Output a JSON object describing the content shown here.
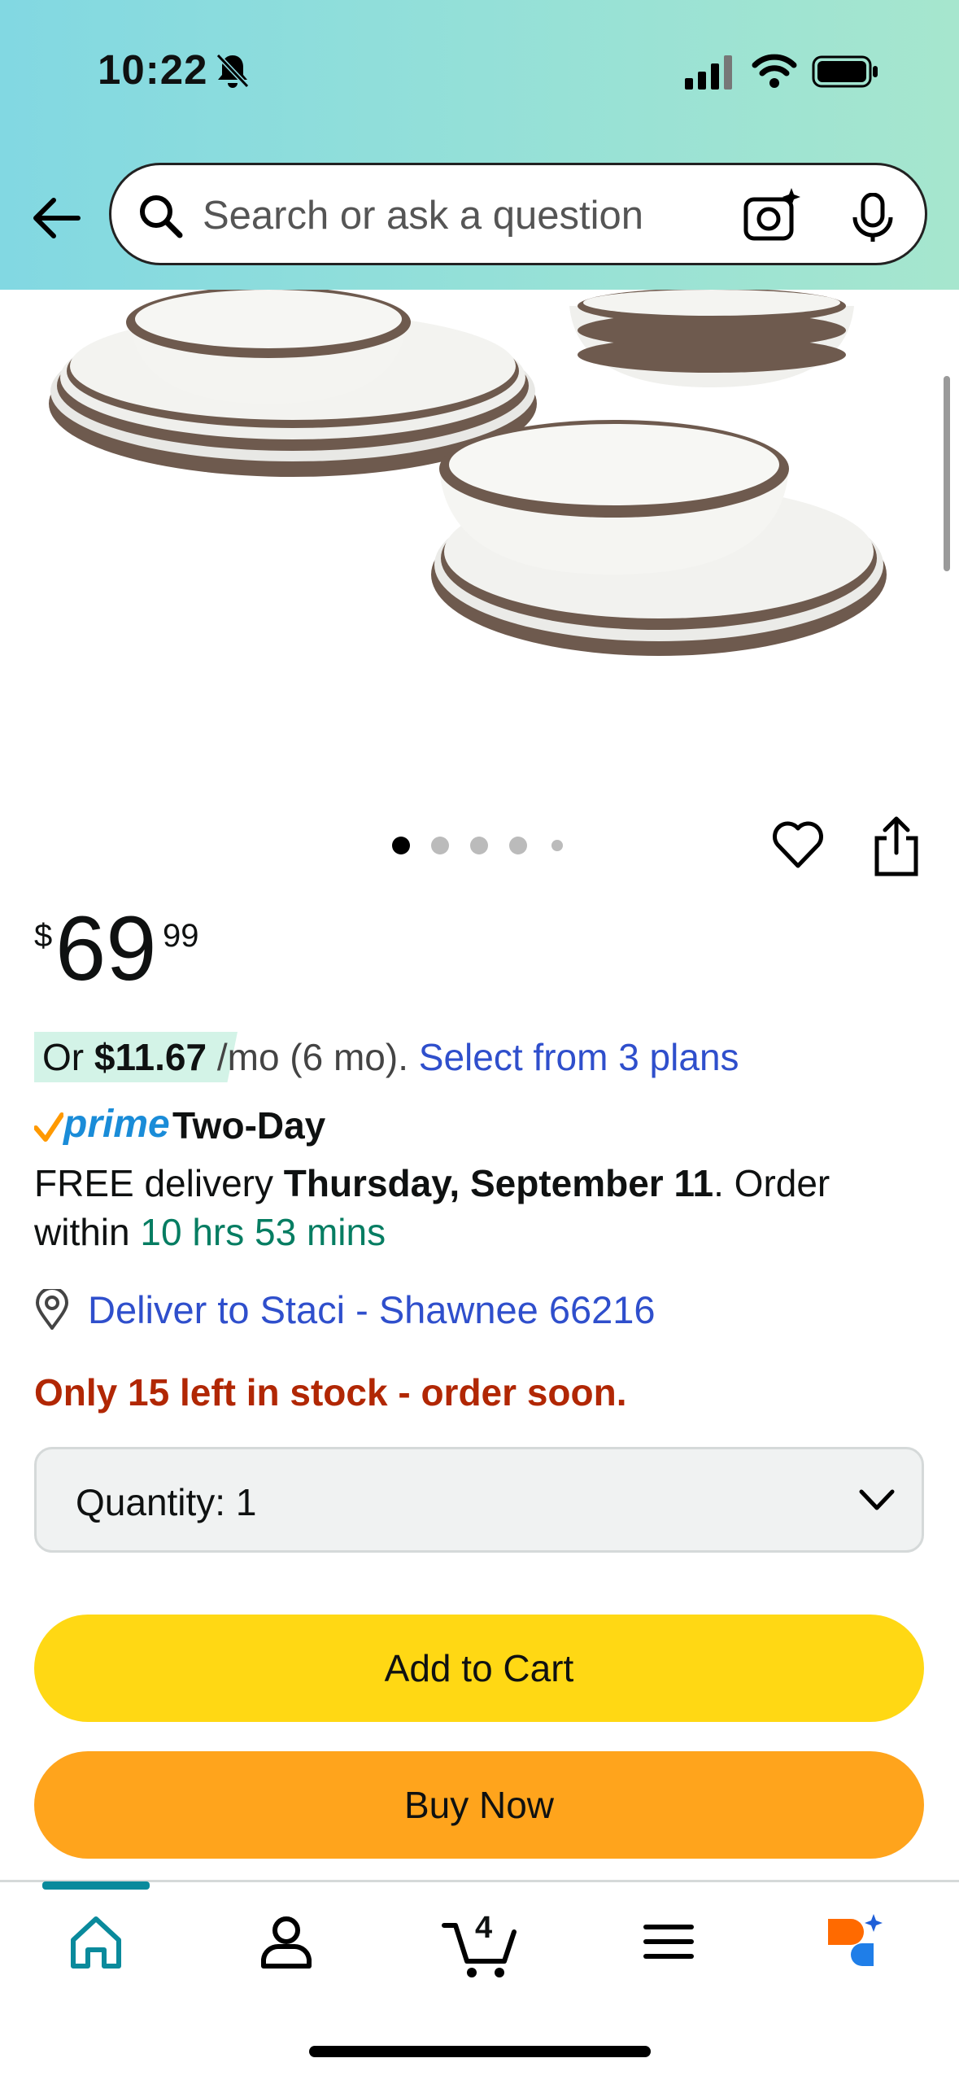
{
  "status_bar": {
    "time": "10:22"
  },
  "search": {
    "placeholder": "Search or ask a question"
  },
  "product": {
    "price": {
      "currency": "$",
      "whole": "69",
      "cents": "99"
    },
    "image_carousel": {
      "count": 5,
      "active_index": 0
    }
  },
  "installment": {
    "prefix": "Or ",
    "amount": "$11.67",
    "suffix": " /mo (6 mo). ",
    "link": "Select from 3 plans"
  },
  "delivery": {
    "prime_word": "prime",
    "speed": "Two-Day",
    "free_label": "FREE delivery ",
    "date": "Thursday, September 11",
    "order_within_label": ". Order within ",
    "countdown": "10 hrs 53 mins",
    "deliver_to": "Deliver to Staci - Shawnee 66216"
  },
  "stock_message": "Only 15 left in stock - order soon.",
  "quantity": {
    "label": "Quantity:",
    "value": "1"
  },
  "buttons": {
    "add_to_cart": "Add to Cart",
    "buy_now": "Buy Now"
  },
  "bottom_nav": {
    "items": [
      {
        "icon": "home-icon",
        "active": true
      },
      {
        "icon": "account-icon"
      },
      {
        "icon": "cart-icon",
        "badge": "4"
      },
      {
        "icon": "menu-icon"
      },
      {
        "icon": "rufus-assistant-icon"
      }
    ]
  },
  "colors": {
    "header_gradient_start": "#82d8e2",
    "header_gradient_end": "#a6e6ce",
    "add_to_cart": "#ffd814",
    "buy_now": "#ffa41c",
    "link": "#2f4fcc",
    "stock_warning": "#b12704",
    "countdown": "#067d62",
    "nav_active": "#0a8a9c"
  }
}
